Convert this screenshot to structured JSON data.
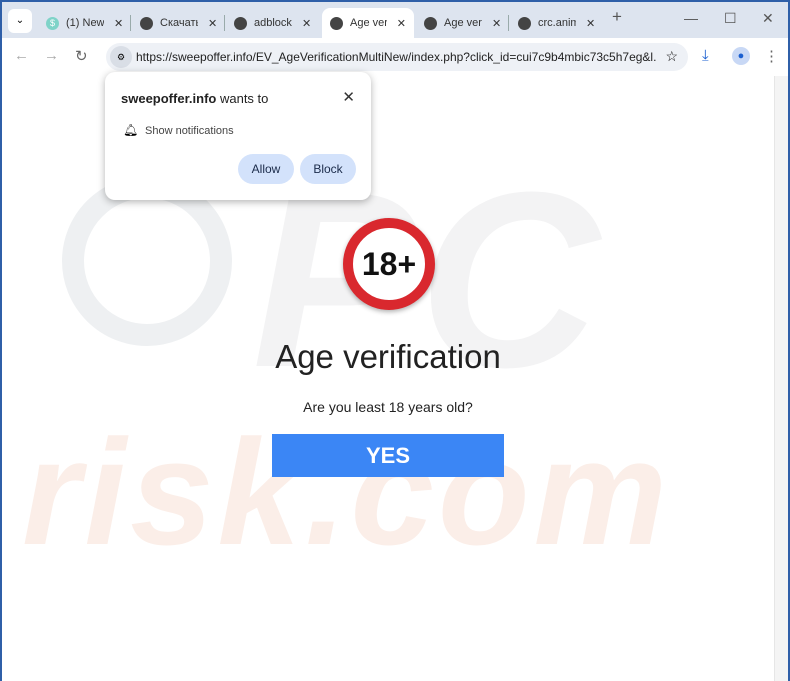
{
  "tabs": [
    {
      "label": "(1) New",
      "icon": "dollar-favicon"
    },
    {
      "label": "Скачать",
      "icon": "globe-icon"
    },
    {
      "label": "adblock",
      "icon": "globe-icon"
    },
    {
      "label": "Age ver",
      "icon": "globe-icon",
      "active": true
    },
    {
      "label": "Age ver",
      "icon": "globe-icon"
    },
    {
      "label": "crc.anim",
      "icon": "globe-icon"
    }
  ],
  "toolbar": {
    "url": "https://sweepoffer.info/EV_AgeVerificationMultiNew/index.php?click_id=cui7c9b4mbic73c5h7eg&l..."
  },
  "popup": {
    "site": "sweepoffer.info",
    "wants": " wants to",
    "permission": "Show notifications",
    "allow": "Allow",
    "block": "Block"
  },
  "page": {
    "badge": "18+",
    "title": "Age verification",
    "question": "Are you least 18 years old?",
    "yes": "YES",
    "badge_color": "#d9282e",
    "button_color": "#3b86f5"
  }
}
